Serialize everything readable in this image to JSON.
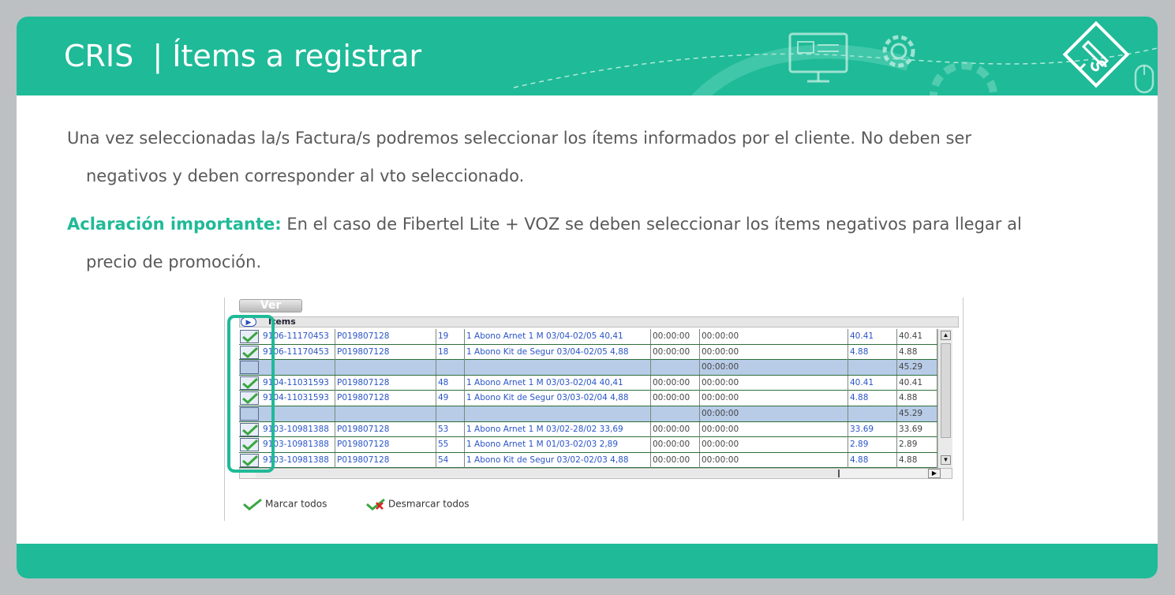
{
  "header": {
    "title": "CRIS  | Ítems a registrar"
  },
  "paragraph1": {
    "line1": "Una vez seleccionadas la/s Factura/s podremos seleccionar los ítems informados por el cliente. No deben ser",
    "line2": "negativos y deben corresponder al vto seleccionado."
  },
  "paragraph2": {
    "highlight": "Aclaración importante:",
    "line1": " En el caso de Fibertel Lite + VOZ se deben seleccionar los ítems negativos para llegar al",
    "line2": "precio de promoción."
  },
  "colors": {
    "accent": "#1fba98",
    "text": "#595959",
    "link": "#2a55c8",
    "row_highlight": "#b8cce8"
  },
  "screenshot": {
    "ver_button": "Ver",
    "items_header": "Ítems",
    "rows": [
      {
        "checked": true,
        "blue": false,
        "factura": "9106-11170453",
        "cuenta": "P019807128",
        "nro": "19",
        "desc": "1 Abono Arnet 1 M 03/04-02/05 40,41",
        "t1": "00:00:00",
        "t2": "00:00:00",
        "imp1": "40.41",
        "imp2": "40.41"
      },
      {
        "checked": true,
        "blue": false,
        "factura": "9106-11170453",
        "cuenta": "P019807128",
        "nro": "18",
        "desc": "1 Abono Kit de Segur 03/04-02/05 4,88",
        "t1": "00:00:00",
        "t2": "00:00:00",
        "imp1": "4.88",
        "imp2": "4.88"
      },
      {
        "checked": false,
        "blue": true,
        "factura": "",
        "cuenta": "",
        "nro": "",
        "desc": "",
        "t1": "",
        "t2": "00:00:00",
        "imp1": "",
        "imp2": "45.29"
      },
      {
        "checked": true,
        "blue": false,
        "factura": "9104-11031593",
        "cuenta": "P019807128",
        "nro": "48",
        "desc": "1 Abono Arnet 1 M 03/03-02/04 40,41",
        "t1": "00:00:00",
        "t2": "00:00:00",
        "imp1": "40.41",
        "imp2": "40.41"
      },
      {
        "checked": true,
        "blue": false,
        "factura": "9104-11031593",
        "cuenta": "P019807128",
        "nro": "49",
        "desc": "1 Abono Kit de Segur 03/03-02/04 4,88",
        "t1": "00:00:00",
        "t2": "00:00:00",
        "imp1": "4.88",
        "imp2": "4.88"
      },
      {
        "checked": false,
        "blue": true,
        "factura": "",
        "cuenta": "",
        "nro": "",
        "desc": "",
        "t1": "",
        "t2": "00:00:00",
        "imp1": "",
        "imp2": "45.29"
      },
      {
        "checked": true,
        "blue": false,
        "factura": "9103-10981388",
        "cuenta": "P019807128",
        "nro": "53",
        "desc": "1 Abono Arnet 1 M 03/02-28/02 33,69",
        "t1": "00:00:00",
        "t2": "00:00:00",
        "imp1": "33.69",
        "imp2": "33.69"
      },
      {
        "checked": true,
        "blue": false,
        "factura": "9103-10981388",
        "cuenta": "P019807128",
        "nro": "55",
        "desc": "1 Abono Arnet 1 M 01/03-02/03 2,89",
        "t1": "00:00:00",
        "t2": "00:00:00",
        "imp1": "2.89",
        "imp2": "2.89"
      },
      {
        "checked": true,
        "blue": false,
        "factura": "9103-10981388",
        "cuenta": "P019807128",
        "nro": "54",
        "desc": "1 Abono Kit de Segur 03/02-02/03 4,88",
        "t1": "00:00:00",
        "t2": "00:00:00",
        "imp1": "4.88",
        "imp2": "4.88"
      }
    ],
    "mark_all": "Marcar todos",
    "unmark_all": "Desmarcar todos"
  }
}
